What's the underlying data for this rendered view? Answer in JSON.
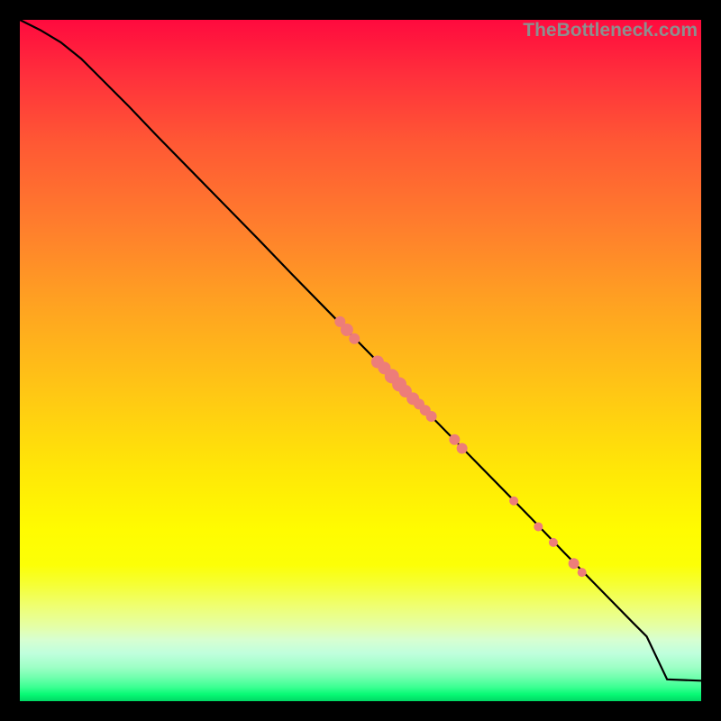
{
  "watermark": "TheBottleneck.com",
  "colors": {
    "point_fill": "#ed7d79",
    "curve_stroke": "#000000"
  },
  "chart_data": {
    "type": "line",
    "title": "",
    "xlabel": "",
    "ylabel": "",
    "xlim": [
      0,
      100
    ],
    "ylim": [
      0,
      100
    ],
    "curve": {
      "x": [
        0,
        3,
        6,
        9,
        12,
        16,
        20,
        25,
        30,
        35,
        40,
        45,
        50,
        55,
        60,
        65,
        70,
        75,
        80,
        85,
        90,
        92,
        95,
        100
      ],
      "y": [
        100,
        98.5,
        96.7,
        94.3,
        91.3,
        87.3,
        83.1,
        78.0,
        72.9,
        67.8,
        62.6,
        57.5,
        52.4,
        47.3,
        42.2,
        37.1,
        32.0,
        26.9,
        21.7,
        16.6,
        11.5,
        9.5,
        3.2,
        3.0
      ]
    },
    "points": [
      {
        "x": 47.0,
        "y": 55.7,
        "r": 6
      },
      {
        "x": 48.0,
        "y": 54.5,
        "r": 7
      },
      {
        "x": 49.1,
        "y": 53.2,
        "r": 6
      },
      {
        "x": 52.5,
        "y": 49.8,
        "r": 7
      },
      {
        "x": 53.5,
        "y": 48.9,
        "r": 7
      },
      {
        "x": 54.6,
        "y": 47.7,
        "r": 8
      },
      {
        "x": 55.7,
        "y": 46.5,
        "r": 8
      },
      {
        "x": 56.6,
        "y": 45.5,
        "r": 7
      },
      {
        "x": 57.7,
        "y": 44.4,
        "r": 7
      },
      {
        "x": 58.6,
        "y": 43.6,
        "r": 6
      },
      {
        "x": 59.5,
        "y": 42.7,
        "r": 6
      },
      {
        "x": 60.4,
        "y": 41.8,
        "r": 6
      },
      {
        "x": 63.8,
        "y": 38.4,
        "r": 6
      },
      {
        "x": 64.9,
        "y": 37.1,
        "r": 6
      },
      {
        "x": 72.5,
        "y": 29.4,
        "r": 5
      },
      {
        "x": 76.1,
        "y": 25.6,
        "r": 5
      },
      {
        "x": 78.3,
        "y": 23.3,
        "r": 5
      },
      {
        "x": 81.3,
        "y": 20.2,
        "r": 6
      },
      {
        "x": 82.5,
        "y": 18.9,
        "r": 5
      }
    ]
  }
}
